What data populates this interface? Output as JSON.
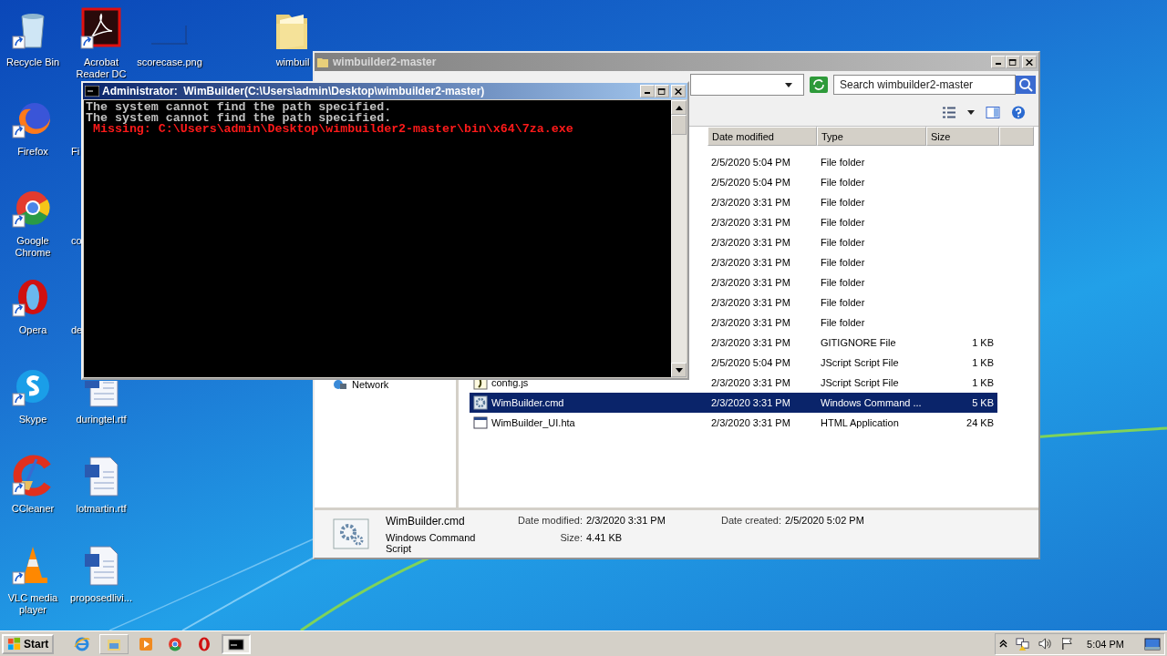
{
  "desktop_icons": [
    {
      "label": "Recycle Bin",
      "kind": "trash"
    },
    {
      "label": "Firefox",
      "kind": "firefox"
    },
    {
      "label": "Google Chrome",
      "kind": "chrome"
    },
    {
      "label": "Opera",
      "kind": "opera"
    },
    {
      "label": "Skype",
      "kind": "skype"
    },
    {
      "label": "CCleaner",
      "kind": "ccleaner"
    },
    {
      "label": "VLC media player",
      "kind": "vlc"
    },
    {
      "label": "Acrobat Reader DC",
      "kind": "acrobat"
    },
    {
      "label": "Fi"
    },
    {
      "label": "co"
    },
    {
      "label": "de"
    },
    {
      "label": "duringtel.rtf",
      "kind": "word"
    },
    {
      "label": "lotmartin.rtf",
      "kind": "word"
    },
    {
      "label": "proposedlivi...",
      "kind": "word"
    },
    {
      "label": "scorecase.png",
      "kind": "image"
    },
    {
      "label": "wimbuil",
      "kind": "folder"
    }
  ],
  "explorer": {
    "title": "wimbuilder2-master",
    "search": {
      "placeholder": "Search wimbuilder2-master"
    },
    "nav_items": [
      {
        "label": "Network"
      }
    ],
    "columns": [
      "Date modified",
      "Type",
      "Size"
    ],
    "rows": [
      {
        "date": "2/5/2020 5:04 PM",
        "type": "File folder",
        "selected": false
      },
      {
        "date": "2/5/2020 5:04 PM",
        "type": "File folder",
        "selected": false
      },
      {
        "date": "2/3/2020 3:31 PM",
        "type": "File folder",
        "selected": false
      },
      {
        "date": "2/3/2020 3:31 PM",
        "type": "File folder",
        "selected": false
      },
      {
        "date": "2/3/2020 3:31 PM",
        "type": "File folder",
        "selected": false
      },
      {
        "date": "2/3/2020 3:31 PM",
        "type": "File folder",
        "selected": false
      },
      {
        "date": "2/3/2020 3:31 PM",
        "type": "File folder",
        "selected": false
      },
      {
        "date": "2/3/2020 3:31 PM",
        "type": "File folder",
        "selected": false
      },
      {
        "date": "2/3/2020 3:31 PM",
        "type": "File folder",
        "selected": false
      },
      {
        "date": "2/3/2020 3:31 PM",
        "type": "GITIGNORE File",
        "size": "1 KB",
        "selected": false
      },
      {
        "date": "2/5/2020 5:04 PM",
        "type": "JScript Script File",
        "size": "1 KB",
        "selected": false
      },
      {
        "name": "config.js",
        "kind": "script",
        "date": "2/3/2020 3:31 PM",
        "type": "JScript Script File",
        "size": "1 KB",
        "selected": false
      },
      {
        "name": "WimBuilder.cmd",
        "kind": "command",
        "date": "2/3/2020 3:31 PM",
        "type": "Windows Command ...",
        "size": "5 KB",
        "selected": true
      },
      {
        "name": "WimBuilder_UI.hta",
        "kind": "application",
        "date": "2/3/2020 3:31 PM",
        "type": "HTML Application",
        "size": "24 KB",
        "selected": false
      }
    ],
    "details": {
      "name": "WimBuilder.cmd",
      "type": "Windows Command Script",
      "fields": [
        {
          "label": "Date modified:",
          "value": "2/3/2020 3:31 PM"
        },
        {
          "label": "Date created:",
          "value": "2/5/2020 5:02 PM"
        },
        {
          "label": "Size:",
          "value": "4.41 KB"
        }
      ]
    }
  },
  "console": {
    "title": "Administrator:  WimBuilder(C:\\Users\\admin\\Desktop\\wimbuilder2-master)",
    "lines": [
      {
        "text": "The system cannot find the path specified.",
        "kind": "normal"
      },
      {
        "text": "The system cannot find the path specified.",
        "kind": "normal"
      },
      {
        "text": " Missing: C:\\Users\\admin\\Desktop\\wimbuilder2-master\\bin\\x64\\7za.exe",
        "kind": "error"
      }
    ]
  },
  "taskbar": {
    "start": "Start",
    "apps": [
      {
        "kind": "ie",
        "selected": false
      },
      {
        "kind": "explorer",
        "selected": false
      },
      {
        "kind": "media",
        "selected": false
      },
      {
        "kind": "chrome",
        "selected": false
      },
      {
        "kind": "opera",
        "selected": false
      },
      {
        "kind": "console",
        "selected": true
      }
    ],
    "clock": "5:04 PM"
  }
}
